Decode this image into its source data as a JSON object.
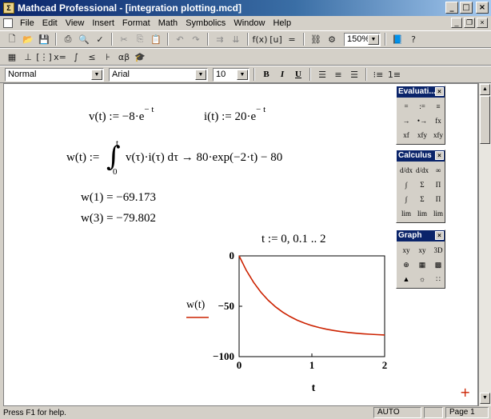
{
  "window": {
    "title": "Mathcad Professional - [integration plotting.mcd]",
    "app_icon": "Σ"
  },
  "menu": [
    "File",
    "Edit",
    "View",
    "Insert",
    "Format",
    "Math",
    "Symbolics",
    "Window",
    "Help"
  ],
  "toolbar": {
    "zoom": "150%"
  },
  "format_bar": {
    "style": "Normal",
    "font": "Arial",
    "size": "10",
    "bold": "B",
    "italic": "I",
    "underline": "U"
  },
  "worksheet": {
    "v_def": "v(t) := −8·e",
    "v_exp": "− t",
    "i_def": "i(t) := 20·e",
    "i_exp": "− t",
    "w_lhs": "w(t) :=",
    "w_integrand": "v(τ)·i(τ) dτ → 80·exp(−2·t) − 80",
    "w_upper": "t",
    "w_lower": "0",
    "w1": "w(1) = −69.173",
    "w3": "w(3) = −79.802",
    "range": "t := 0, 0.1 .. 2"
  },
  "plot": {
    "ylabel": "w(t)",
    "xlabel": "t",
    "y_ticks": [
      "0",
      "−50",
      "−100"
    ],
    "x_ticks": [
      "0",
      "1",
      "2"
    ]
  },
  "chart_data": {
    "type": "line",
    "title": "",
    "xlabel": "t",
    "ylabel": "w(t)",
    "xlim": [
      0,
      2
    ],
    "ylim": [
      -100,
      0
    ],
    "series": [
      {
        "name": "w(t)",
        "x": [
          0,
          0.1,
          0.2,
          0.3,
          0.4,
          0.5,
          0.6,
          0.7,
          0.8,
          0.9,
          1.0,
          1.1,
          1.2,
          1.3,
          1.4,
          1.5,
          1.6,
          1.7,
          1.8,
          1.9,
          2.0
        ],
        "y": [
          0,
          -14.5,
          -26.37,
          -36.08,
          -44.05,
          -50.57,
          -55.9,
          -60.26,
          -63.85,
          -66.78,
          -69.17,
          -71.14,
          -72.74,
          -74.06,
          -75.13,
          -76.02,
          -76.74,
          -77.33,
          -77.81,
          -78.21,
          -78.53
        ]
      }
    ],
    "colors": {
      "line": "#cc2200"
    }
  },
  "palettes": {
    "evaluation": {
      "title": "Evaluati...",
      "cells": [
        "=",
        ":=",
        "≡",
        "→",
        "•→",
        "fx",
        "xf",
        "xfy",
        "xfy"
      ]
    },
    "calculus": {
      "title": "Calculus",
      "cells": [
        "d/dx",
        "d/dx",
        "∞",
        "∫",
        "Σ",
        "Π",
        "∫",
        "Σ",
        "Π",
        "lim",
        "lim",
        "lim"
      ]
    },
    "graph": {
      "title": "Graph",
      "cells": [
        "xy",
        "xy",
        "3D",
        "⊕",
        "▦",
        "▩",
        "▲",
        "☼",
        "∷"
      ]
    }
  },
  "status": {
    "help": "Press F1 for help.",
    "mode": "AUTO",
    "page": "Page 1"
  }
}
